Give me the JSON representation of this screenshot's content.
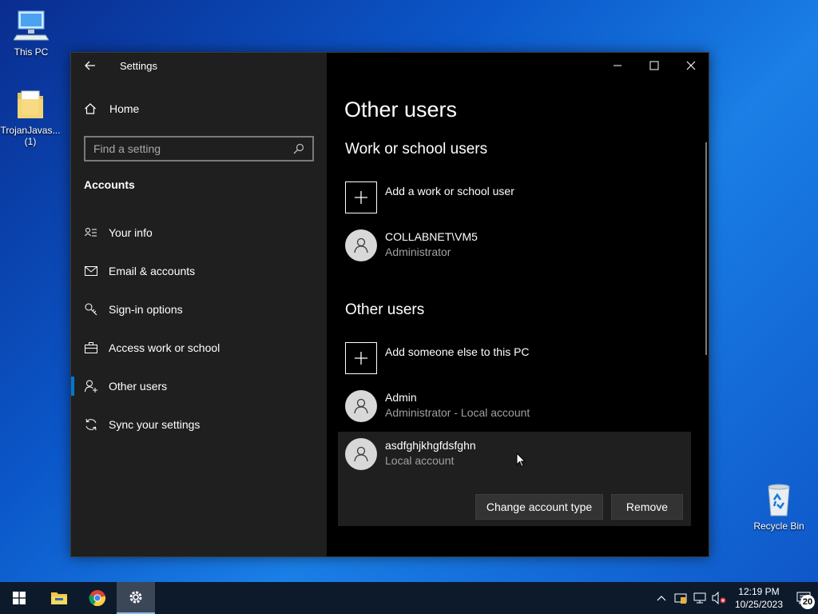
{
  "desktop": {
    "icons": [
      {
        "label": "This PC"
      },
      {
        "label": "TrojanJavas... (1)"
      },
      {
        "label": "Recycle Bin"
      }
    ]
  },
  "window": {
    "title": "Settings",
    "sidebar": {
      "home_label": "Home",
      "search_placeholder": "Find a setting",
      "section_title": "Accounts",
      "items": [
        {
          "label": "Your info",
          "icon": "person-card-icon"
        },
        {
          "label": "Email & accounts",
          "icon": "mail-icon"
        },
        {
          "label": "Sign-in options",
          "icon": "key-icon"
        },
        {
          "label": "Access work or school",
          "icon": "briefcase-icon"
        },
        {
          "label": "Other users",
          "icon": "person-add-icon",
          "selected": true
        },
        {
          "label": "Sync your settings",
          "icon": "sync-icon"
        }
      ]
    },
    "main": {
      "page_title": "Other users",
      "work_heading": "Work or school users",
      "add_work_label": "Add a work or school user",
      "work_users": [
        {
          "name": "COLLABNET\\VM5",
          "role": "Administrator"
        }
      ],
      "other_heading": "Other users",
      "add_other_label": "Add someone else to this PC",
      "other_users": [
        {
          "name": "Admin",
          "role": "Administrator - Local account"
        },
        {
          "name": "asdfghjkhgfdsfghn",
          "role": "Local account",
          "expanded": true
        }
      ],
      "change_button": "Change account type",
      "remove_button": "Remove"
    }
  },
  "taskbar": {
    "time": "12:19 PM",
    "date": "10/25/2023",
    "notification_count": "20"
  },
  "colors": {
    "accent": "#0078d4",
    "sidebar_bg": "#1f1f1f",
    "main_bg": "#000000"
  }
}
